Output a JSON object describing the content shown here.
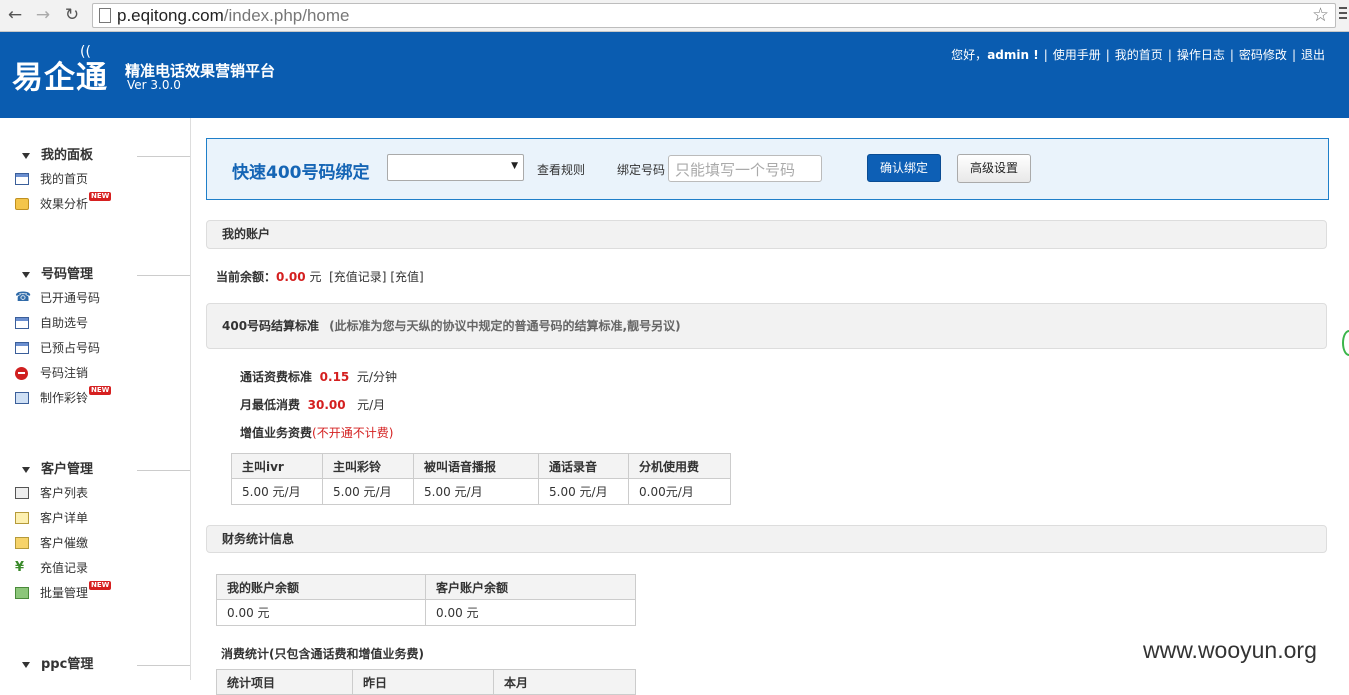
{
  "browser": {
    "url_host": "p.eqitong.com",
    "url_path": "/index.php/home"
  },
  "header": {
    "logo": "易企通",
    "slogan": "精准电话效果营销平台",
    "version": "Ver 3.0.0",
    "greeting": "您好，",
    "username": "admin !",
    "links": [
      "使用手册",
      "我的首页",
      "操作日志",
      "密码修改",
      "退出"
    ]
  },
  "sidebar": {
    "groups": [
      {
        "title": "我的面板",
        "items": [
          {
            "label": "我的首页",
            "icon": "window-icon",
            "new": false
          },
          {
            "label": "效果分析",
            "icon": "chart-icon",
            "new": true
          }
        ]
      },
      {
        "title": "号码管理",
        "items": [
          {
            "label": "已开通号码",
            "icon": "phone-icon",
            "new": false
          },
          {
            "label": "自助选号",
            "icon": "window-icon",
            "new": false
          },
          {
            "label": "已预占号码",
            "icon": "window-icon",
            "new": false
          },
          {
            "label": "号码注销",
            "icon": "stop-icon",
            "new": false
          },
          {
            "label": "制作彩铃",
            "icon": "music-note-icon",
            "new": true
          }
        ]
      },
      {
        "title": "客户管理",
        "items": [
          {
            "label": "客户列表",
            "icon": "list-icon",
            "new": false
          },
          {
            "label": "客户详单",
            "icon": "document-icon",
            "new": false
          },
          {
            "label": "客户催缴",
            "icon": "card-icon",
            "new": false
          },
          {
            "label": "充值记录",
            "icon": "yen-icon",
            "new": false
          },
          {
            "label": "批量管理",
            "icon": "stack-icon",
            "new": true
          }
        ]
      },
      {
        "title": "ppc管理",
        "items": []
      }
    ],
    "new_badge": "NEW"
  },
  "bind": {
    "title": "快速400号码绑定",
    "select_value": "",
    "rule_link": "查看规则",
    "number_label": "绑定号码",
    "number_placeholder": "只能填写一个号码",
    "confirm_button": "确认绑定",
    "advanced_button": "高级设置"
  },
  "account": {
    "section_title": "我的账户",
    "balance_label": "当前余额：",
    "balance_value": "0.00",
    "balance_unit": "元",
    "recharge_record_link": "[充值记录]",
    "recharge_link": "[充值]"
  },
  "settlement": {
    "section_title": "400号码结算标准",
    "section_note": "(此标准为您与天纵的协议中规定的普通号码的结算标准,靓号另议)",
    "call_fee_label": "通话资费标准",
    "call_fee_value": "0.15",
    "call_fee_unit": "元/分钟",
    "min_fee_label": "月最低消费",
    "min_fee_value": "30.00",
    "min_fee_unit": "元/月",
    "vas_label": "增值业务资费",
    "vas_note": "(不开通不计费)",
    "table_headers": [
      "主叫ivr",
      "主叫彩铃",
      "被叫语音播报",
      "通话录音",
      "分机使用费"
    ],
    "table_values": [
      "5.00 元/月",
      "5.00 元/月",
      "5.00 元/月",
      "5.00 元/月",
      "0.00元/月"
    ]
  },
  "finance": {
    "section_title": "财务统计信息",
    "table_headers": [
      "我的账户余额",
      "客户账户余额"
    ],
    "table_values": [
      "0.00 元",
      "0.00 元"
    ],
    "consumption_title": "消费统计(只包含通话费和增值业务费)",
    "consumption_headers": [
      "统计项目",
      "昨日",
      "本月"
    ]
  },
  "watermark": "www.wooyun.org"
}
